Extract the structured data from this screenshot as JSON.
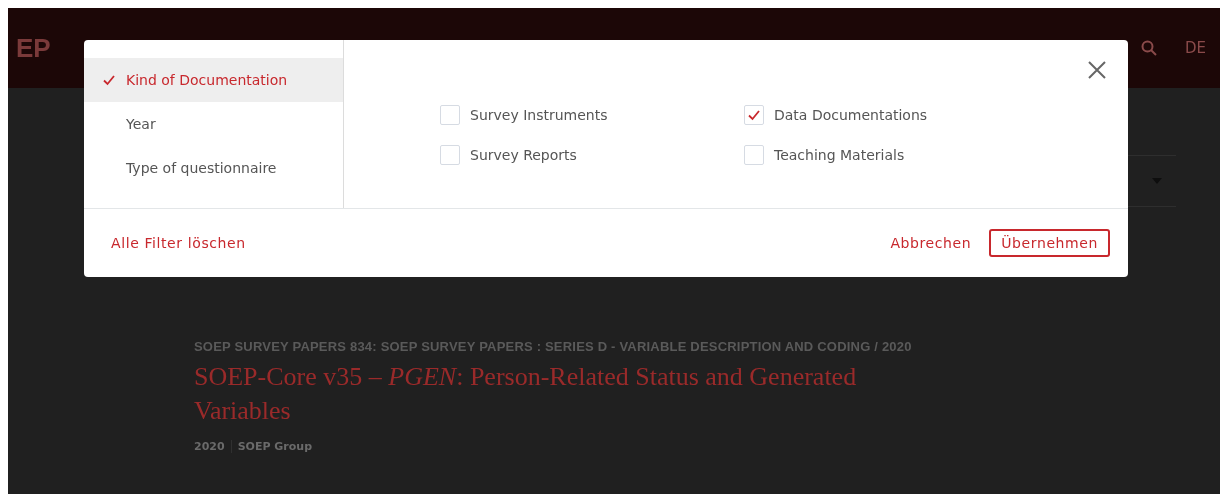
{
  "header": {
    "logo": "EP",
    "language": "DE"
  },
  "result": {
    "series": "SOEP SURVEY PAPERS 834: SOEP SURVEY PAPERS : SERIES D - VARIABLE DESCRIPTION AND CODING / 2020",
    "title": "SOEP-Core v35 – *PGEN*: Person-Related Status and Generated Variables",
    "year": "2020",
    "author": "SOEP Group"
  },
  "filter_dialog": {
    "categories": [
      {
        "label": "Kind of Documentation",
        "selected": true
      },
      {
        "label": "Year",
        "selected": false
      },
      {
        "label": "Type of questionnaire",
        "selected": false
      }
    ],
    "options": [
      {
        "label": "Survey Instruments",
        "checked": false
      },
      {
        "label": "Data Documentations",
        "checked": true
      },
      {
        "label": "Survey Reports",
        "checked": false
      },
      {
        "label": "Teaching Materials",
        "checked": false
      }
    ],
    "clear_link": "Alle Filter löschen",
    "cancel_button": "Abbrechen",
    "apply_button": "Übernehmen"
  }
}
